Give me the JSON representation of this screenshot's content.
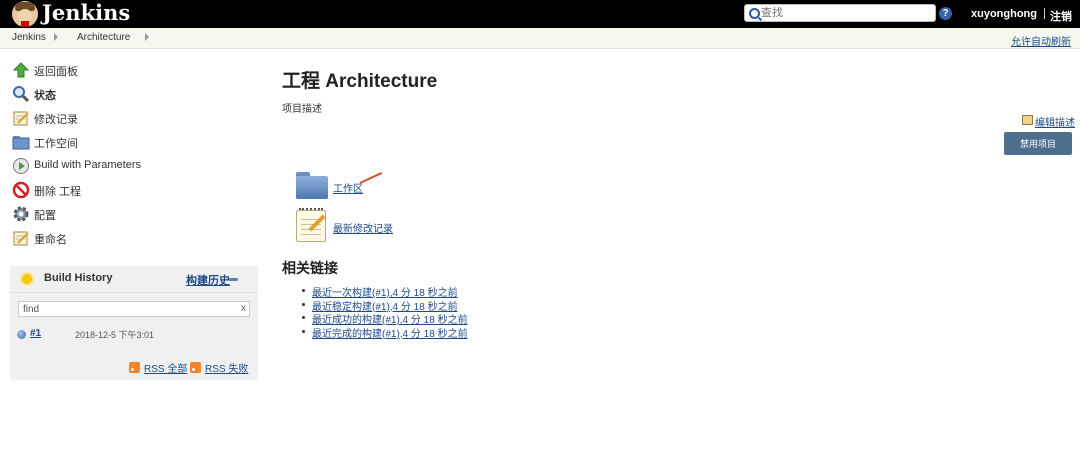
{
  "header": {
    "brand": "Jenkins",
    "search_placeholder": "查找",
    "help_label": "?",
    "username": "xuyonghong",
    "logout": "注销"
  },
  "breadcrumb": {
    "items": [
      "Jenkins",
      "Architecture"
    ],
    "auto_refresh": "允许自动刷新"
  },
  "sidebar": {
    "tasks": [
      {
        "label": "返回面板",
        "icon": "up-arrow-icon"
      },
      {
        "label": "状态",
        "icon": "magnifier-icon"
      },
      {
        "label": "修改记录",
        "icon": "notepad-icon"
      },
      {
        "label": "工作空间",
        "icon": "folder-icon"
      },
      {
        "label": "Build with Parameters",
        "icon": "clock-play-icon"
      },
      {
        "label": "删除 工程",
        "icon": "no-entry-icon"
      },
      {
        "label": "配置",
        "icon": "gear-icon"
      },
      {
        "label": "重命名",
        "icon": "notepad-icon"
      }
    ]
  },
  "build_history": {
    "title": "Build History",
    "trend_link": "构建历史",
    "filter_value": "find",
    "clear": "x",
    "builds": [
      {
        "number": "#1",
        "date": "2018-12-5 下午3:01"
      }
    ],
    "rss_all": "RSS 全部",
    "rss_failed": "RSS 失败"
  },
  "main": {
    "title": "工程 Architecture",
    "description": "项目描述",
    "edit_description": "编辑描述",
    "disable_button": "禁用项目",
    "workspace_link": "工作区",
    "changes_link": "最新修改记录",
    "related_title": "相关链接",
    "permalinks": [
      "最近一次构建(#1),4 分 18 秒之前",
      "最近稳定构建(#1),4 分 18 秒之前",
      "最近成功的构建(#1),4 分 18 秒之前",
      "最近完成的构建(#1),4 分 18 秒之前"
    ]
  },
  "colors": {
    "header_bg": "#000000",
    "link": "#204a87",
    "disable_button_bg": "#4e6e8e"
  }
}
